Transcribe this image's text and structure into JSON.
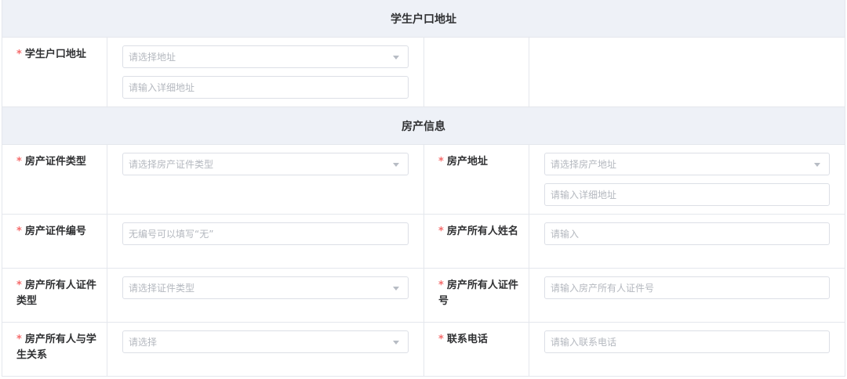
{
  "section1": {
    "title": "学生户口地址",
    "row1": {
      "label": "学生户口地址",
      "select_placeholder": "请选择地址",
      "detail_placeholder": "请输入详细地址"
    }
  },
  "section2": {
    "title": "房产信息",
    "rows": [
      {
        "left_label": "房产证件类型",
        "left_placeholder": "请选择房产证件类型",
        "right_label": "房产地址",
        "right_select_placeholder": "请选择房产地址",
        "right_detail_placeholder": "请输入详细地址"
      },
      {
        "left_label": "房产证件编号",
        "left_placeholder": "无编号可以填写“无”",
        "right_label": "房产所有人姓名",
        "right_placeholder": "请输入"
      },
      {
        "left_label": "房产所有人证件类型",
        "left_placeholder": "请选择证件类型",
        "right_label": "房产所有人证件号",
        "right_placeholder": "请输入房产所有人证件号"
      },
      {
        "left_label": "房产所有人与学生关系",
        "left_placeholder": "请选择",
        "right_label": "联系电话",
        "right_placeholder": "请输入联系电话"
      }
    ]
  },
  "required_mark": "*",
  "colors": {
    "required": "#f56c6c",
    "header_bg": "#eef1f7",
    "border": "#e4e7ed",
    "placeholder": "#b4b8bf"
  },
  "icons": {
    "select_arrow": "caret-down-icon"
  }
}
